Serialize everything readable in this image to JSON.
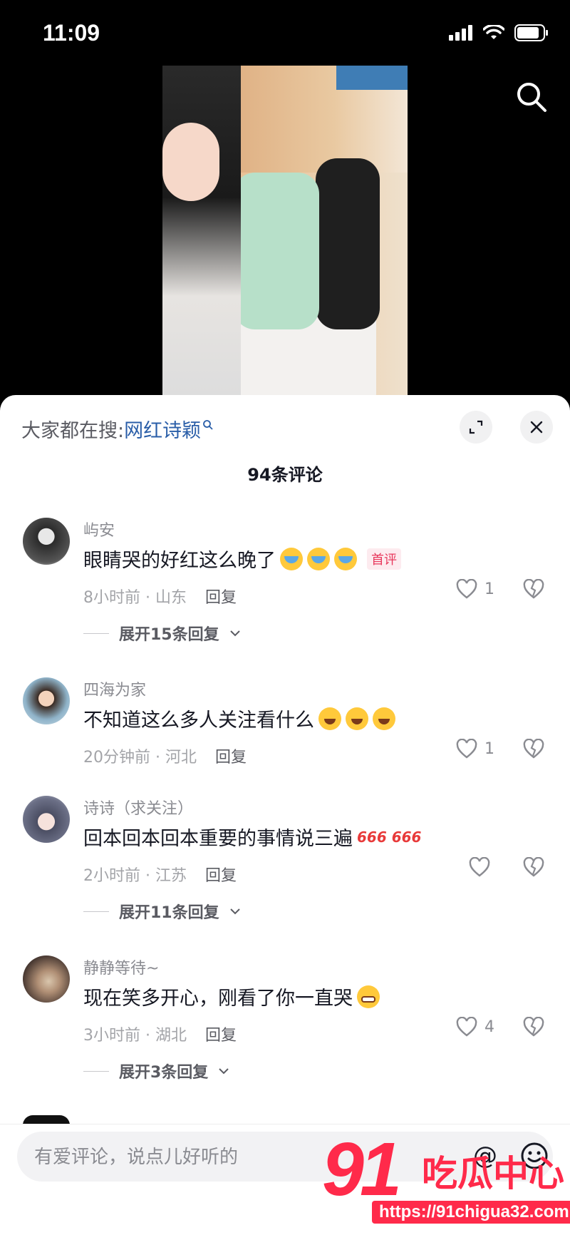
{
  "status_bar": {
    "time": "11:09"
  },
  "hot_search": {
    "prefix": "大家都在搜:",
    "keyword": "网红诗颖"
  },
  "comment_count": "94条评论",
  "comments": [
    {
      "username": "屿安",
      "text": "眼睛哭的好红这么晚了",
      "emojis": [
        "cry",
        "cry",
        "cry"
      ],
      "badge": "首评",
      "time_location": "8小时前 · 山东",
      "reply_label": "回复",
      "likes": "1",
      "expand_label": "展开15条回复"
    },
    {
      "username": "四海为家",
      "text": "不知道这么多人关注看什么",
      "emojis": [
        "laugh",
        "laugh",
        "laugh"
      ],
      "time_location": "20分钟前 · 河北",
      "reply_label": "回复",
      "likes": "1"
    },
    {
      "username": "诗诗（求关注）",
      "text": "回本回本回本重要的事情说三遍",
      "extra": "666 666",
      "time_location": "2小时前 · 江苏",
      "reply_label": "回复",
      "likes": "",
      "expand_label": "展开11条回复"
    },
    {
      "username": "静静等待~",
      "text": "现在笑多开心，刚看了你一直哭",
      "emojis": [
        "grin"
      ],
      "time_location": "3小时前 · 湖北",
      "reply_label": "回复",
      "likes": "4",
      "expand_label": "展开3条回复"
    }
  ],
  "input": {
    "placeholder": "有爱评论，说点儿好听的",
    "at_symbol": "@"
  },
  "watermark": {
    "number": "91",
    "title": "吃瓜中心",
    "url": "https://91chigua32.com"
  },
  "icons": [
    "signal-icon",
    "wifi-icon",
    "battery-icon",
    "search-icon",
    "expand-icon",
    "close-icon",
    "heart-icon",
    "broken-heart-icon",
    "chevron-down-icon",
    "emoji-icon"
  ]
}
